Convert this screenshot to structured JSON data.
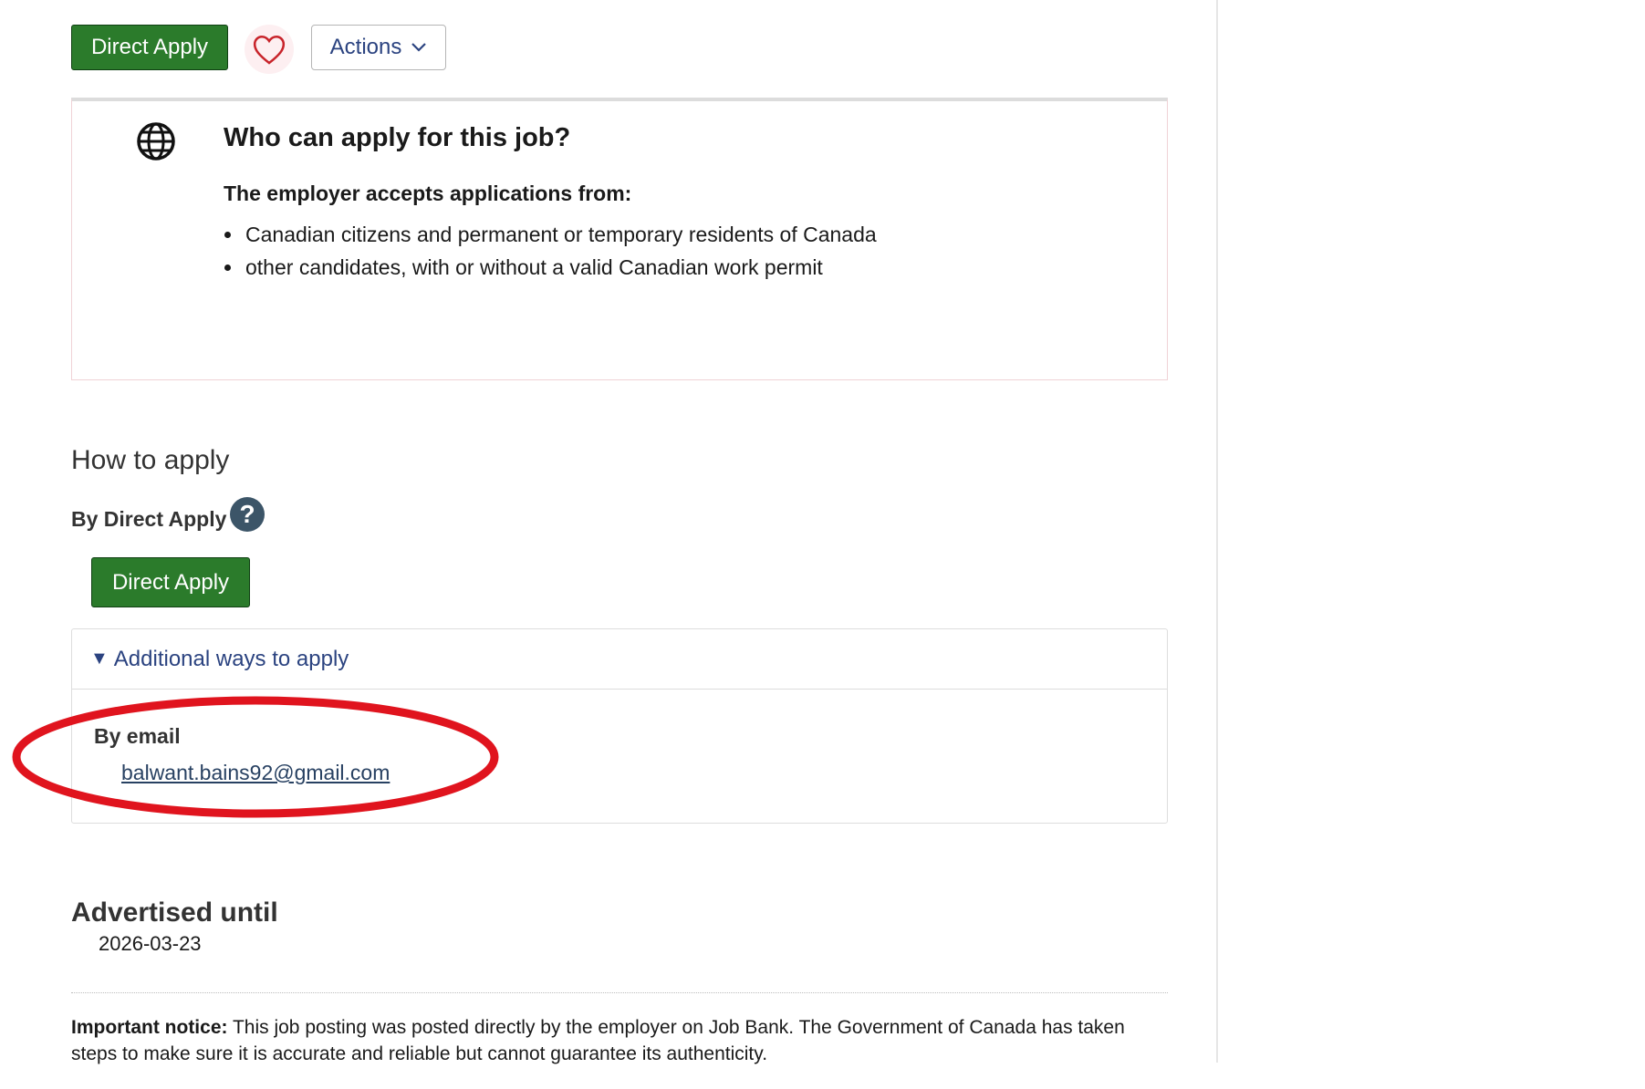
{
  "toolbar": {
    "direct_apply_label": "Direct Apply",
    "favourite_icon": "heart-icon",
    "actions_label": "Actions",
    "actions_icon": "chevron-down-icon"
  },
  "who_can_apply": {
    "icon": "globe-icon",
    "title": "Who can apply for this job?",
    "subtitle": "The employer accepts applications from:",
    "items": [
      "Canadian citizens and permanent or temporary residents of Canada",
      "other candidates, with or without a valid Canadian work permit"
    ]
  },
  "how_to_apply": {
    "heading": "How to apply",
    "by_direct_apply": "By Direct Apply",
    "help_icon": "question-icon",
    "direct_apply_label": "Direct Apply",
    "additional_ways_label": "Additional ways to apply",
    "by_email_label": "By email",
    "email": "balwant.bains92@gmail.com"
  },
  "advertised": {
    "heading": "Advertised until",
    "date": "2026-03-23"
  },
  "notice": {
    "label": "Important notice:",
    "text": " This job posting was posted directly by the employer on Job Bank. The Government of Canada has taken steps to make sure it is accurate and reliable but cannot guarantee its authenticity."
  },
  "colors": {
    "apply_green": "#2b7b2b",
    "link_blue": "#2b4380",
    "highlight_red": "#e0141e"
  }
}
